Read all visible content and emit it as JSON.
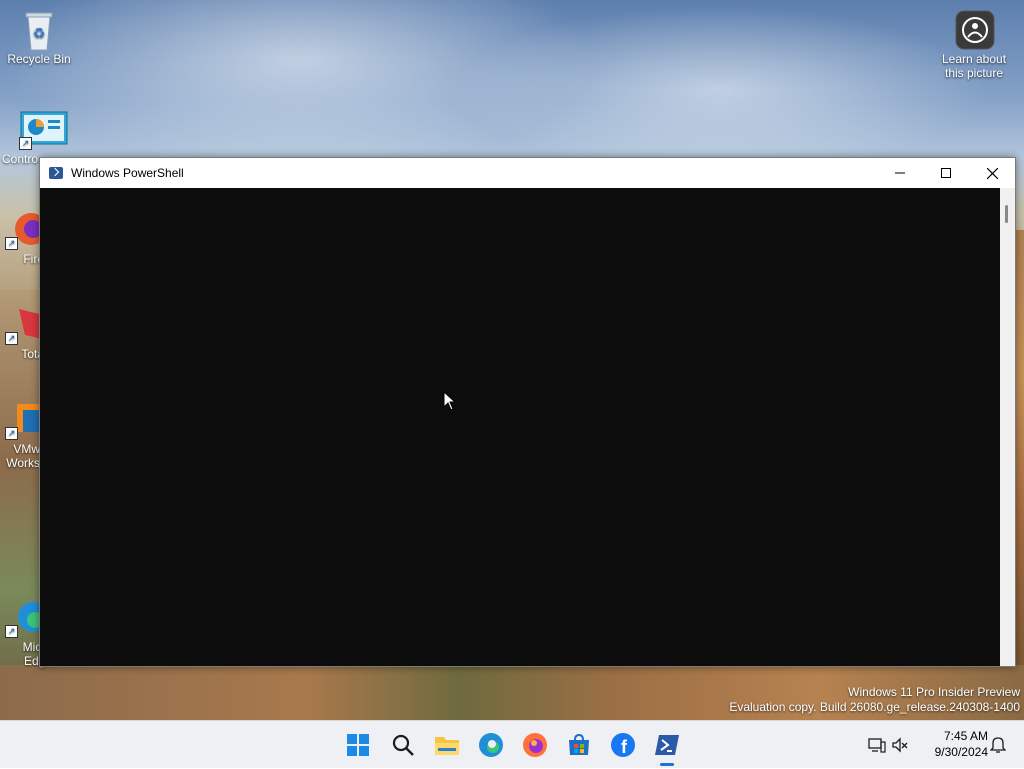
{
  "desktop": {
    "icons": [
      {
        "label": "Recycle Bin",
        "icon": "recycle-bin-icon"
      },
      {
        "label": "Contro",
        "icon": "control-panel-icon"
      },
      {
        "label": "Fire",
        "icon": "firefox-icon"
      },
      {
        "label": "Tota",
        "icon": "total-commander-icon"
      },
      {
        "label": "VMw Works",
        "icon": "vmware-workstation-icon"
      },
      {
        "label": "Micro Edge",
        "icon": "edge-icon"
      }
    ],
    "learn_icon_label": "Learn about this picture",
    "watermark_line1": "Windows 11 Pro Insider Preview",
    "watermark_line2": "Evaluation copy. Build 26080.ge_release.240308-1400"
  },
  "window": {
    "title": "Windows PowerShell",
    "icon": "powershell-icon",
    "buttons": [
      "minimize",
      "maximize",
      "close"
    ],
    "background": "#0c0c0c"
  },
  "taskbar": {
    "apps": [
      {
        "name": "start",
        "icon": "windows-start-icon"
      },
      {
        "name": "search",
        "icon": "search-icon"
      },
      {
        "name": "file-explorer",
        "icon": "file-explorer-icon"
      },
      {
        "name": "edge",
        "icon": "edge-icon"
      },
      {
        "name": "firefox",
        "icon": "firefox-icon"
      },
      {
        "name": "store",
        "icon": "microsoft-store-icon"
      },
      {
        "name": "facebook",
        "icon": "facebook-icon"
      },
      {
        "name": "powershell",
        "icon": "powershell-icon",
        "active": true
      }
    ],
    "time": "7:45 AM",
    "date": "9/30/2024",
    "accent": "#1a73d9"
  }
}
